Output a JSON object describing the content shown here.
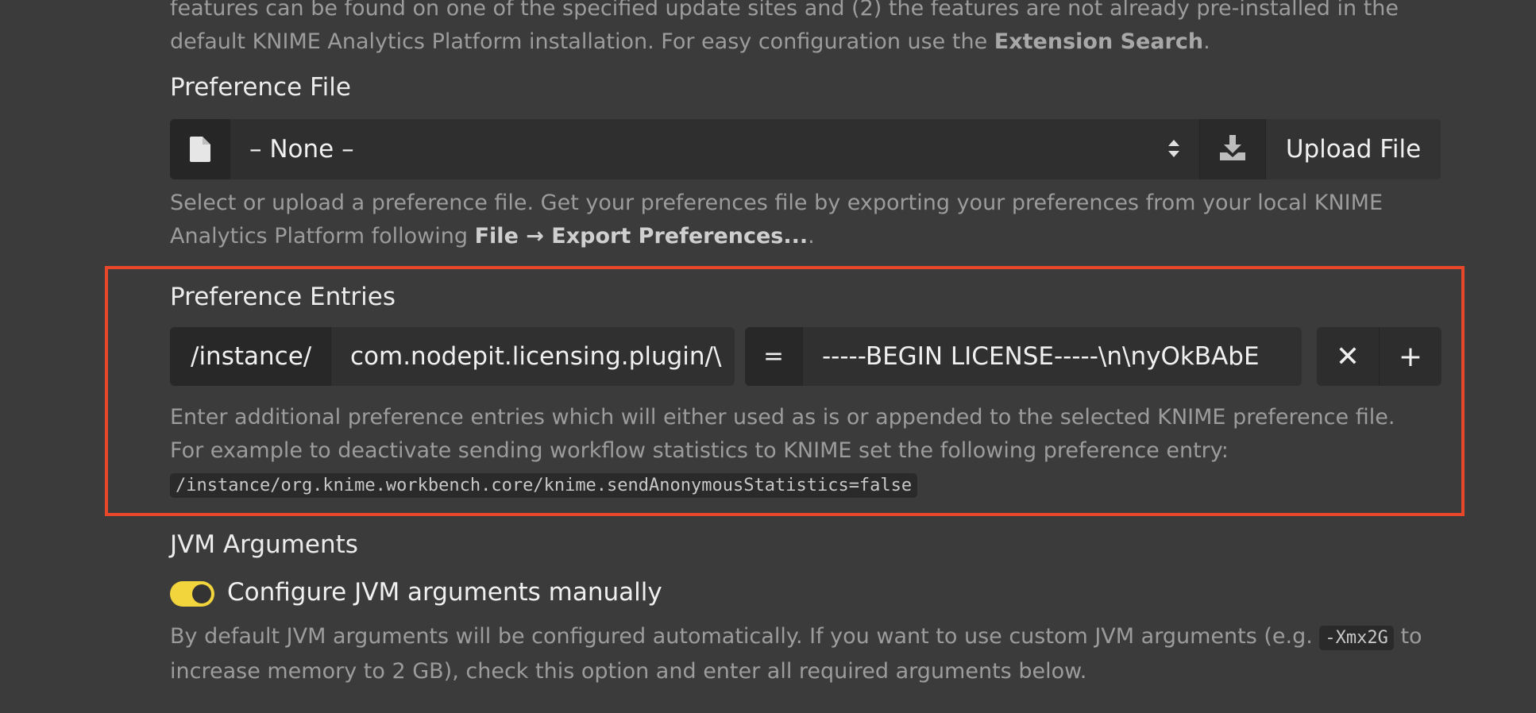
{
  "top_text": {
    "line1": "features can be found on one of the specified update sites and (2) the features are not already pre-installed in the",
    "line2_pre": "default KNIME Analytics Platform installation. For easy configuration use the ",
    "line2_bold": "Extension Search",
    "line2_post": "."
  },
  "preference_file": {
    "label": "Preference File",
    "file_icon": "file-icon",
    "selected": "– None –",
    "select_icon": "sort-arrows-icon",
    "download_icon": "download-icon",
    "upload_label": "Upload File",
    "help_pre": "Select or upload a preference file. Get your preferences file by exporting your preferences from your local KNIME Analytics Platform following ",
    "help_bold": "File → Export Preferences...",
    "help_post": "."
  },
  "preference_entries": {
    "label": "Preference Entries",
    "scope": "/instance/",
    "key": "com.nodepit.licensing.plugin/\\",
    "equals": "=",
    "value": "-----BEGIN LICENSE-----\\n\\nyOkBAbE",
    "remove_symbol": "✕",
    "add_symbol": "+",
    "help_text": "Enter additional preference entries which will either used as is or appended to the selected KNIME preference file. For example to deactivate sending workflow statistics to KNIME set the following preference entry:",
    "help_code": "/instance/org.knime.workbench.core/knime.sendAnonymousStatistics=false"
  },
  "jvm": {
    "label": "JVM Arguments",
    "toggle_on": true,
    "toggle_label": "Configure JVM arguments manually",
    "help_pre": "By default JVM arguments will be configured automatically. If you want to use custom JVM arguments (e.g. ",
    "help_code": "-Xmx2G",
    "help_post": " to increase memory to 2 GB), check this option and enter all required arguments below."
  },
  "colors": {
    "background": "#3b3b3b",
    "highlight_border": "#e8472a",
    "toggle_accent": "#f2d53c"
  }
}
